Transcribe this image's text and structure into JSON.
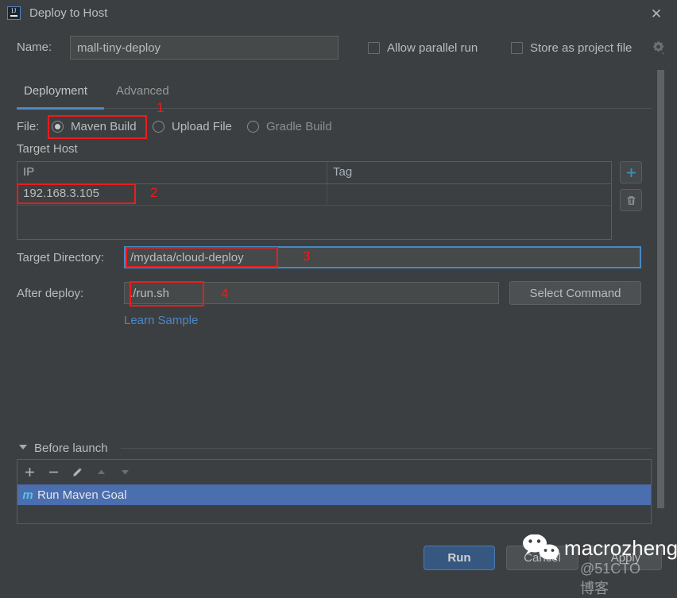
{
  "window": {
    "title": "Deploy to Host",
    "app_icon": "intellij-idea-icon",
    "close_label": "✕"
  },
  "name_row": {
    "label": "Name:",
    "value": "mall-tiny-deploy",
    "allow_parallel_run": "Allow parallel run",
    "store_as_project_file": "Store as project file",
    "gear": "gear-icon"
  },
  "tabs": [
    {
      "label": "Deployment",
      "active": true
    },
    {
      "label": "Advanced",
      "active": false
    }
  ],
  "file_row": {
    "label": "File:",
    "options": [
      {
        "label": "Maven Build",
        "selected": true
      },
      {
        "label": "Upload File",
        "selected": false
      },
      {
        "label": "Gradle Build",
        "selected": false
      }
    ]
  },
  "target_host": {
    "label": "Target Host",
    "columns": [
      "IP",
      "Tag"
    ],
    "rows": [
      {
        "ip": "192.168.3.105",
        "tag": ""
      }
    ],
    "add_button": "+",
    "delete_button": "trash-icon"
  },
  "target_directory": {
    "label": "Target Directory:",
    "value": "/mydata/cloud-deploy"
  },
  "after_deploy": {
    "label": "After deploy:",
    "value": "./run.sh",
    "select_command": "Select Command",
    "learn_sample": "Learn Sample"
  },
  "before_launch": {
    "title": "Before launch",
    "toolbar": [
      "+",
      "−",
      "pencil-icon",
      "arrow-up-icon",
      "arrow-down-icon"
    ],
    "items": [
      {
        "icon": "m",
        "label": "Run Maven Goal",
        "selected": true
      }
    ]
  },
  "footer": {
    "run": "Run",
    "cancel": "Cancel",
    "apply": "Apply"
  },
  "annotations": [
    {
      "number": "1"
    },
    {
      "number": "2"
    },
    {
      "number": "3"
    },
    {
      "number": "4"
    }
  ],
  "watermark": {
    "text": "macrozheng",
    "sub": "@51CTO博客"
  },
  "colors": {
    "background": "#3c3f41",
    "accent_blue": "#4a88c7",
    "selection_blue": "#4b6eaf",
    "run_button": "#365880",
    "annotation_red": "#ee1b1b",
    "link_blue": "#4a88c7",
    "maven_icon": "#58c3e8"
  }
}
